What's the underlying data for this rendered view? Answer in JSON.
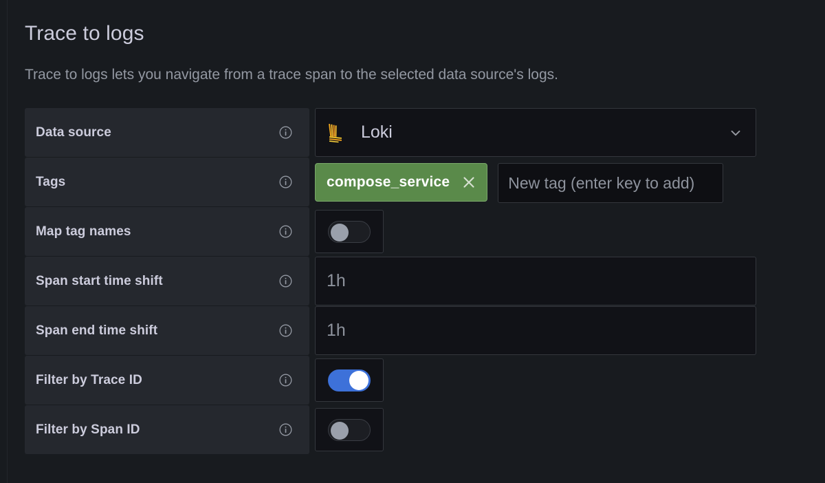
{
  "section": {
    "title": "Trace to logs",
    "description": "Trace to logs lets you navigate from a trace span to the selected data source's logs."
  },
  "colors": {
    "background": "#181b1f",
    "label_row": "#25282e",
    "field_background": "#111217",
    "field_border": "#34373d",
    "text_primary": "#ccccdc",
    "text_secondary": "#9398a2",
    "tag_green": "#5a8a4a",
    "toggle_on_blue": "#3d71d9",
    "toggle_knob_off": "#9aa0ab",
    "loki_orange": "#f2a81d"
  },
  "rows": {
    "data_source": {
      "label": "Data source",
      "info_icon": "info-circle-icon",
      "selected_value": "Loki",
      "logo_icon": "loki-logo-icon",
      "dropdown_icon": "chevron-down-icon"
    },
    "tags": {
      "label": "Tags",
      "info_icon": "info-circle-icon",
      "tag_items": [
        {
          "label": "compose_service",
          "remove_icon": "close-x-icon"
        }
      ],
      "new_tag_placeholder": "New tag (enter key to add)",
      "new_tag_value": ""
    },
    "map_tag_names": {
      "label": "Map tag names",
      "info_icon": "info-circle-icon",
      "toggle_state": "off"
    },
    "span_start_time_shift": {
      "label": "Span start time shift",
      "info_icon": "info-circle-icon",
      "placeholder": "1h",
      "value": ""
    },
    "span_end_time_shift": {
      "label": "Span end time shift",
      "info_icon": "info-circle-icon",
      "placeholder": "1h",
      "value": ""
    },
    "filter_by_trace_id": {
      "label": "Filter by Trace ID",
      "info_icon": "info-circle-icon",
      "toggle_state": "on"
    },
    "filter_by_span_id": {
      "label": "Filter by Span ID",
      "info_icon": "info-circle-icon",
      "toggle_state": "off"
    }
  }
}
